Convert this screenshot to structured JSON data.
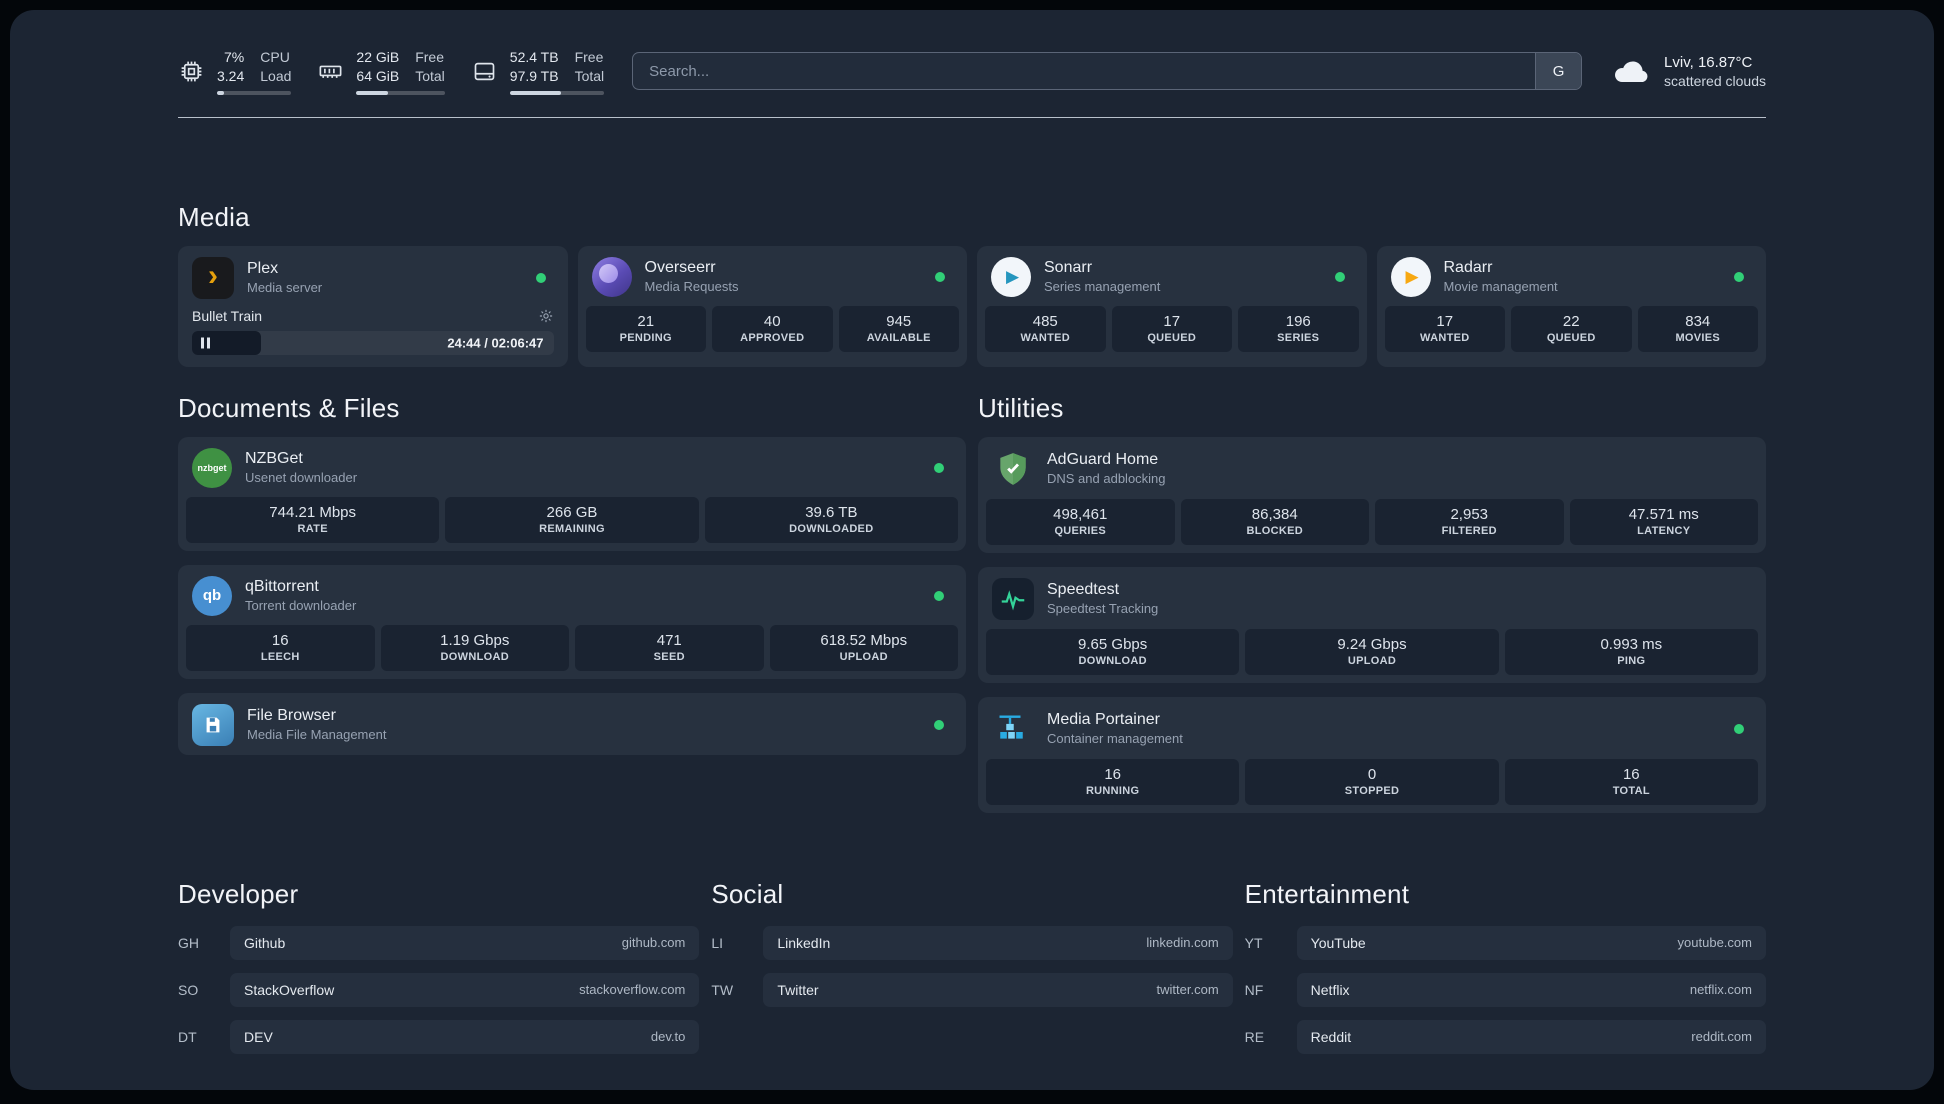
{
  "colors": {
    "status_online": "#31cf77",
    "plex_amber": "#e5a00d",
    "sonarr_blue": "#2596be",
    "radarr_amber": "#f7a811",
    "overseerr_purple": "#5a4bb4",
    "nzbget_green": "#3f9143",
    "qbittorrent_blue": "#478fd1",
    "adguard_green": "#67a56b",
    "speedtest_green": "#34d399",
    "portainer_blue": "#29abe2"
  },
  "system": {
    "cpu": {
      "value1": "7%",
      "value2": "3.24",
      "label1": "CPU",
      "label2": "Load"
    },
    "memory": {
      "value1": "22 GiB",
      "value2": "64 GiB",
      "label1": "Free",
      "label2": "Total"
    },
    "disk": {
      "value1": "52.4 TB",
      "value2": "97.9 TB",
      "label1": "Free",
      "label2": "Total"
    }
  },
  "search": {
    "placeholder": "Search...",
    "provider": "G"
  },
  "weather": {
    "location": "Lviv, 16.87°C",
    "condition": "scattered clouds"
  },
  "sections": {
    "media": {
      "title": "Media",
      "apps": [
        {
          "name": "Plex",
          "desc": "Media server",
          "icon_glyph": "›",
          "now_playing": {
            "title": "Bullet Train",
            "time": "24:44 / 02:06:47"
          }
        },
        {
          "name": "Overseerr",
          "desc": "Media Requests",
          "stats": [
            {
              "value": "21",
              "label": "PENDING"
            },
            {
              "value": "40",
              "label": "APPROVED"
            },
            {
              "value": "945",
              "label": "AVAILABLE"
            }
          ]
        },
        {
          "name": "Sonarr",
          "desc": "Series management",
          "icon_glyph": "▶",
          "stats": [
            {
              "value": "485",
              "label": "WANTED"
            },
            {
              "value": "17",
              "label": "QUEUED"
            },
            {
              "value": "196",
              "label": "SERIES"
            }
          ]
        },
        {
          "name": "Radarr",
          "desc": "Movie management",
          "icon_glyph": "▶",
          "stats": [
            {
              "value": "17",
              "label": "WANTED"
            },
            {
              "value": "22",
              "label": "QUEUED"
            },
            {
              "value": "834",
              "label": "MOVIES"
            }
          ]
        }
      ]
    },
    "documents": {
      "title": "Documents & Files",
      "apps": [
        {
          "name": "NZBGet",
          "desc": "Usenet downloader",
          "icon_text": "nzbget",
          "stats": [
            {
              "value": "744.21 Mbps",
              "label": "RATE"
            },
            {
              "value": "266 GB",
              "label": "REMAINING"
            },
            {
              "value": "39.6 TB",
              "label": "DOWNLOADED"
            }
          ]
        },
        {
          "name": "qBittorrent",
          "desc": "Torrent downloader",
          "icon_text": "qb",
          "stats": [
            {
              "value": "16",
              "label": "LEECH"
            },
            {
              "value": "1.19 Gbps",
              "label": "DOWNLOAD"
            },
            {
              "value": "471",
              "label": "SEED"
            },
            {
              "value": "618.52 Mbps",
              "label": "UPLOAD"
            }
          ]
        },
        {
          "name": "File Browser",
          "desc": "Media File Management"
        }
      ]
    },
    "utilities": {
      "title": "Utilities",
      "apps": [
        {
          "name": "AdGuard Home",
          "desc": "DNS and adblocking",
          "stats": [
            {
              "value": "498,461",
              "label": "QUERIES"
            },
            {
              "value": "86,384",
              "label": "BLOCKED"
            },
            {
              "value": "2,953",
              "label": "FILTERED"
            },
            {
              "value": "47.571 ms",
              "label": "LATENCY"
            }
          ]
        },
        {
          "name": "Speedtest",
          "desc": "Speedtest Tracking",
          "stats": [
            {
              "value": "9.65 Gbps",
              "label": "DOWNLOAD"
            },
            {
              "value": "9.24 Gbps",
              "label": "UPLOAD"
            },
            {
              "value": "0.993 ms",
              "label": "PING"
            }
          ]
        },
        {
          "name": "Media Portainer",
          "desc": "Container management",
          "stats": [
            {
              "value": "16",
              "label": "RUNNING"
            },
            {
              "value": "0",
              "label": "STOPPED"
            },
            {
              "value": "16",
              "label": "TOTAL"
            }
          ]
        }
      ]
    }
  },
  "bookmarks": {
    "developer": {
      "title": "Developer",
      "items": [
        {
          "abbr": "GH",
          "name": "Github",
          "url": "github.com"
        },
        {
          "abbr": "SO",
          "name": "StackOverflow",
          "url": "stackoverflow.com"
        },
        {
          "abbr": "DT",
          "name": "DEV",
          "url": "dev.to"
        }
      ]
    },
    "social": {
      "title": "Social",
      "items": [
        {
          "abbr": "LI",
          "name": "LinkedIn",
          "url": "linkedin.com"
        },
        {
          "abbr": "TW",
          "name": "Twitter",
          "url": "twitter.com"
        }
      ]
    },
    "entertainment": {
      "title": "Entertainment",
      "items": [
        {
          "abbr": "YT",
          "name": "YouTube",
          "url": "youtube.com"
        },
        {
          "abbr": "NF",
          "name": "Netflix",
          "url": "netflix.com"
        },
        {
          "abbr": "RE",
          "name": "Reddit",
          "url": "reddit.com"
        }
      ]
    }
  }
}
